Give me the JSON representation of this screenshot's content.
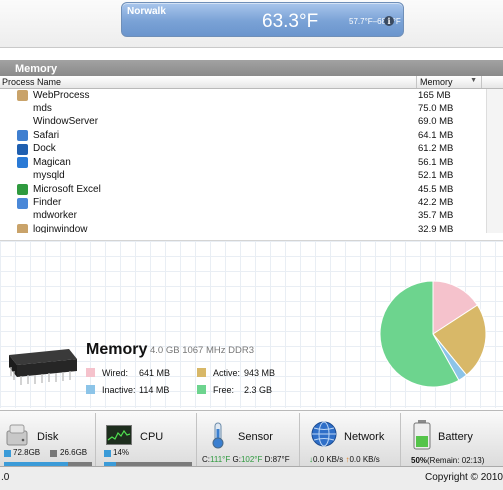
{
  "weather": {
    "city": "Norwalk",
    "temp": "63.3°F",
    "range": "57.7°F–68.9°F",
    "icon": "info-icon"
  },
  "memory_panel": {
    "title": "Memory",
    "col_process": "Process Name",
    "col_memory": "Memory",
    "processes": [
      {
        "name": "WebProcess",
        "mem": "165 MB",
        "icon": "webprocess-icon",
        "color": "#c9a36a"
      },
      {
        "name": "mds",
        "mem": "75.0 MB",
        "icon": "",
        "color": ""
      },
      {
        "name": "WindowServer",
        "mem": "69.0 MB",
        "icon": "",
        "color": ""
      },
      {
        "name": "Safari",
        "mem": "64.1 MB",
        "icon": "safari-icon",
        "color": "#3f7fd0"
      },
      {
        "name": "Dock",
        "mem": "61.2 MB",
        "icon": "dock-icon",
        "color": "#1f5fb0"
      },
      {
        "name": "Magican",
        "mem": "56.1 MB",
        "icon": "magican-icon",
        "color": "#2a7ad6"
      },
      {
        "name": "mysqld",
        "mem": "52.1 MB",
        "icon": "",
        "color": ""
      },
      {
        "name": "Microsoft Excel",
        "mem": "45.5 MB",
        "icon": "excel-icon",
        "color": "#2f9a3f"
      },
      {
        "name": "Finder",
        "mem": "42.2 MB",
        "icon": "finder-icon",
        "color": "#4a88d8"
      },
      {
        "name": "mdworker",
        "mem": "35.7 MB",
        "icon": "",
        "color": ""
      },
      {
        "name": "loginwindow",
        "mem": "32.9 MB",
        "icon": "loginwindow-icon",
        "color": "#c9a36a"
      }
    ]
  },
  "memory_summary": {
    "title": "Memory",
    "spec": "4.0 GB 1067 MHz DDR3",
    "wired_label": "Wired:",
    "wired_value": "641 MB",
    "inactive_label": "Inactive:",
    "inactive_value": "114 MB",
    "active_label": "Active:",
    "active_value": "943 MB",
    "free_label": "Free:",
    "free_value": "2.3 GB",
    "colors": {
      "wired": "#f5c2cc",
      "inactive": "#8cc4e8",
      "active": "#d8b868",
      "free": "#6dd48e"
    },
    "pie": [
      {
        "name": "Wired",
        "value": 641,
        "color": "#f5c2cc"
      },
      {
        "name": "Active",
        "value": 943,
        "color": "#d8b868"
      },
      {
        "name": "Inactive",
        "value": 114,
        "color": "#8cc4e8"
      },
      {
        "name": "Free",
        "value": 2355,
        "color": "#6dd48e"
      }
    ]
  },
  "toolbar": {
    "disk": {
      "label": "Disk",
      "used": "72.8GB",
      "free": "26.6GB",
      "fill": 0.73
    },
    "cpu": {
      "label": "CPU",
      "usage": "14%",
      "fill": 0.14
    },
    "sensor": {
      "label": "Sensor",
      "c_label": "C:",
      "c": "111°F",
      "g_label": "G:",
      "g": "102°F",
      "d_label": "D:",
      "d": "87°F"
    },
    "network": {
      "label": "Network",
      "down": "0.0 KB/s",
      "up": "0.0 KB/s"
    },
    "battery": {
      "label": "Battery",
      "percent": "50%",
      "remain": "(Remain: 02:13)"
    }
  },
  "status": {
    "version": ".0",
    "copyright": "Copyright © 2010"
  }
}
